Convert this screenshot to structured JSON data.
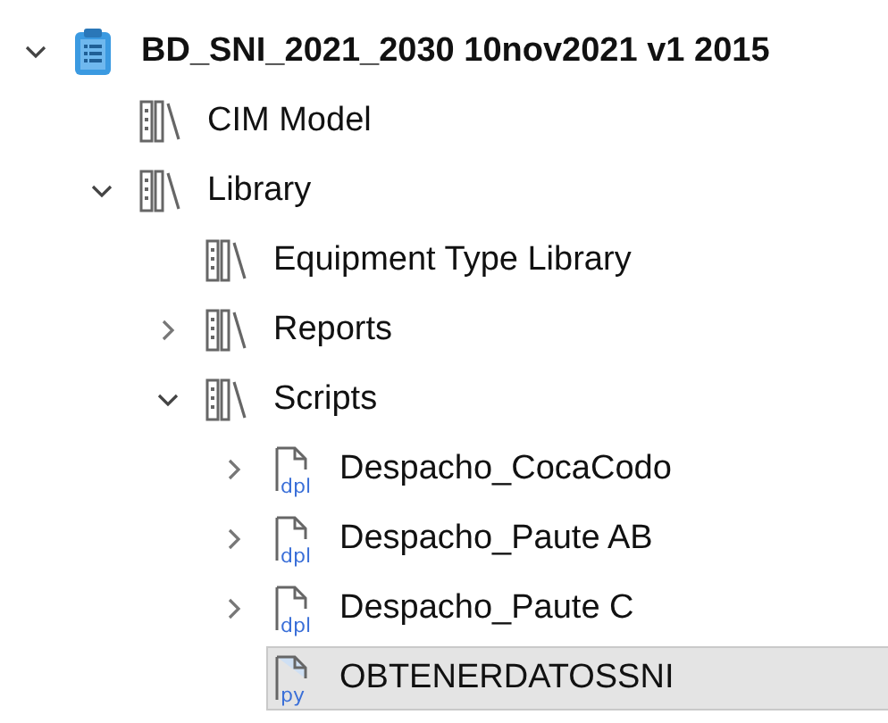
{
  "tree": [
    {
      "label": "BD_SNI_2021_2030 10nov2021 v1 2015",
      "kind": "project",
      "expanded": true,
      "selected": false,
      "children": [
        {
          "label": "CIM Model",
          "kind": "library",
          "selected": false
        },
        {
          "label": "Library",
          "kind": "library",
          "expanded": true,
          "selected": false,
          "children": [
            {
              "label": "Equipment Type Library",
              "kind": "library",
              "selected": false
            },
            {
              "label": "Reports",
              "kind": "library",
              "expanded": false,
              "selected": false
            },
            {
              "label": "Scripts",
              "kind": "library",
              "expanded": true,
              "selected": false,
              "children": [
                {
                  "label": "Despacho_CocaCodo",
                  "kind": "script",
                  "badge": "dpl",
                  "expanded": false,
                  "selected": false
                },
                {
                  "label": "Despacho_Paute AB",
                  "kind": "script",
                  "badge": "dpl",
                  "expanded": false,
                  "selected": false
                },
                {
                  "label": "Despacho_Paute C",
                  "kind": "script",
                  "badge": "dpl",
                  "expanded": false,
                  "selected": false
                },
                {
                  "label": "OBTENERDATOSSNI",
                  "kind": "script",
                  "badge": "py",
                  "selected": true
                }
              ]
            }
          ]
        }
      ]
    }
  ]
}
